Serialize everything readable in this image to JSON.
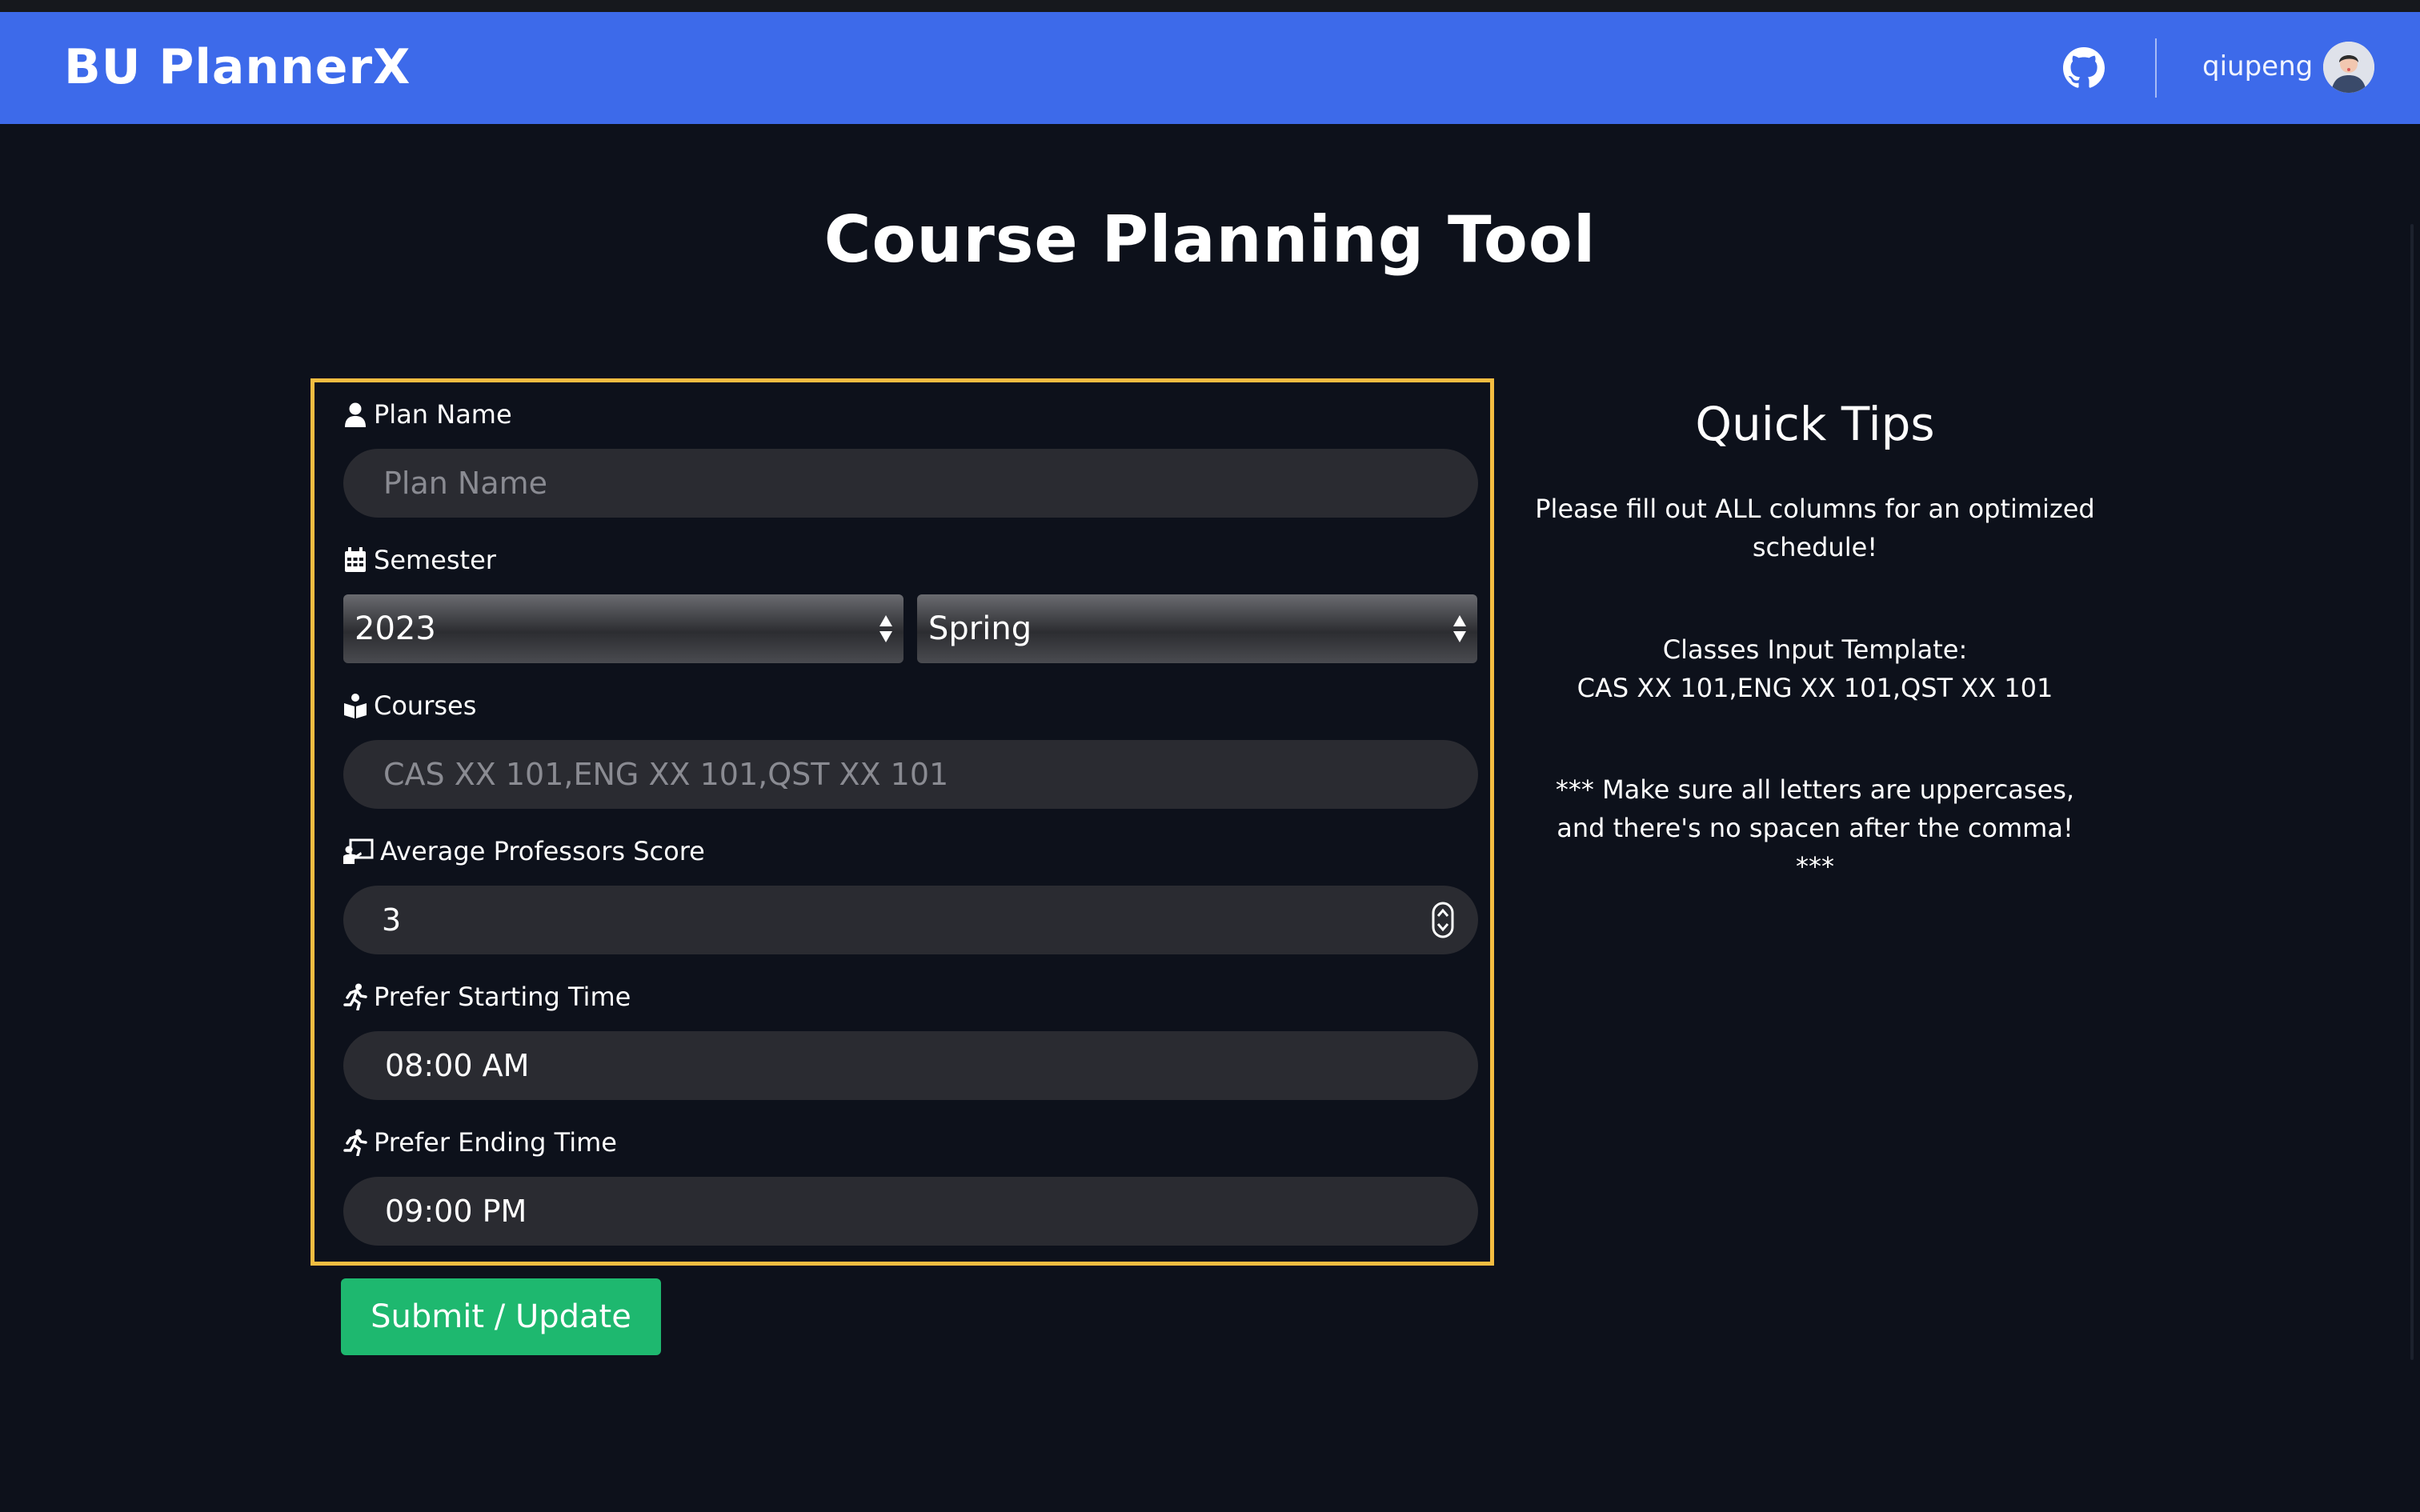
{
  "navbar": {
    "brand": "BU PlannerX",
    "github_icon": "github-icon",
    "username": "qiupeng",
    "avatar_icon": "user-avatar-icon"
  },
  "page_title": "Course Planning Tool",
  "form": {
    "plan_name": {
      "label": "Plan Name",
      "placeholder": "Plan Name",
      "value": "",
      "icon": "user-icon"
    },
    "semester": {
      "label": "Semester",
      "icon": "calendar-icon",
      "year": "2023",
      "term": "Spring"
    },
    "courses": {
      "label": "Courses",
      "placeholder": "CAS XX 101,ENG XX 101,QST XX 101",
      "value": "",
      "icon": "book-reader-icon"
    },
    "professor_score": {
      "label": "Average Professors Score",
      "value": "3",
      "icon": "teacher-board-icon"
    },
    "start_time": {
      "label": "Prefer Starting Time",
      "value": "08:00 AM",
      "icon": "running-icon"
    },
    "end_time": {
      "label": "Prefer Ending Time",
      "value": "09:00 PM",
      "icon": "running-icon"
    },
    "submit_label": "Submit / Update"
  },
  "tips": {
    "title": "Quick Tips",
    "line1": "Please fill out ALL columns for an optimized schedule!",
    "template_label": "Classes Input Template:",
    "template_value": "CAS XX 101,ENG XX 101,QST XX 101",
    "warning_stars_open": "***",
    "warning_text": "Make sure all letters are uppercases, and there's no spacen after the comma!",
    "warning_stars_close": "***"
  },
  "colors": {
    "navbar": "#3d6aea",
    "background": "#0d111b",
    "form_border": "#f4bd41",
    "submit": "#1eb86f",
    "field": "#2a2b31"
  }
}
